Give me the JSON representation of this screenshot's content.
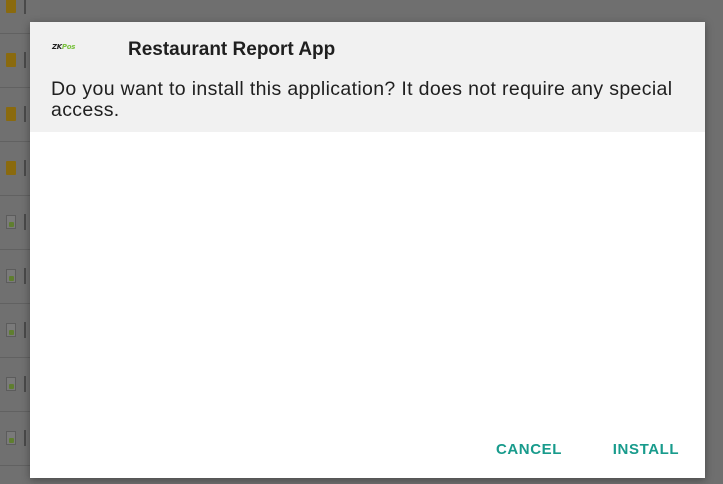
{
  "background": {
    "rows": [
      {
        "icon": "folder-icon"
      },
      {
        "icon": "folder-icon"
      },
      {
        "icon": "folder-icon"
      },
      {
        "icon": "folder-icon"
      },
      {
        "icon": "apk-file-icon"
      },
      {
        "icon": "apk-file-icon"
      },
      {
        "icon": "apk-file-icon"
      },
      {
        "icon": "apk-file-icon"
      },
      {
        "icon": "apk-file-icon"
      }
    ]
  },
  "dialog": {
    "icon": {
      "name": "zkpos-app-icon",
      "text_a": "ZK",
      "text_b": "Pos"
    },
    "title": "Restaurant Report App",
    "message": "Do you want to install this application? It does not require any special access.",
    "cancel_label": "CANCEL",
    "install_label": "INSTALL",
    "accent_color": "#189b8c"
  }
}
